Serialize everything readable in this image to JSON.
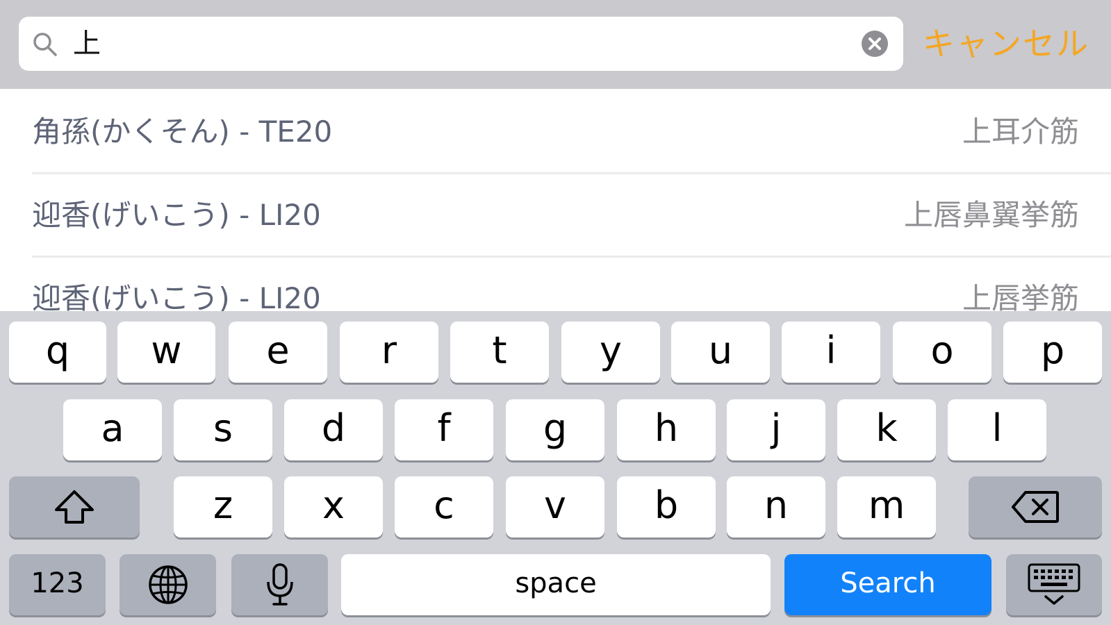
{
  "search": {
    "value": "上",
    "cancel_label": "キャンセル"
  },
  "results": [
    {
      "title": "角孫(かくそん) - TE20",
      "subtitle": "上耳介筋"
    },
    {
      "title": "迎香(げいこう) - LI20",
      "subtitle": "上唇鼻翼挙筋"
    },
    {
      "title": "迎香(げいこう) - LI20",
      "subtitle": "上唇挙筋"
    }
  ],
  "keyboard": {
    "row1": [
      "q",
      "w",
      "e",
      "r",
      "t",
      "y",
      "u",
      "i",
      "o",
      "p"
    ],
    "row2": [
      "a",
      "s",
      "d",
      "f",
      "g",
      "h",
      "j",
      "k",
      "l"
    ],
    "row3": [
      "z",
      "x",
      "c",
      "v",
      "b",
      "n",
      "m"
    ],
    "numbers_label": "123",
    "space_label": "space",
    "search_label": "Search",
    "shift_icon": "shift-arrow-icon",
    "delete_icon": "backspace-icon",
    "globe_icon": "globe-icon",
    "mic_icon": "microphone-icon",
    "dismiss_icon": "keyboard-dismiss-icon"
  },
  "colors": {
    "accent": "#f5a623",
    "search_key": "#1282fb",
    "keyboard_bg": "#d1d3d9",
    "searchbar_bg": "#c9c9ce"
  }
}
